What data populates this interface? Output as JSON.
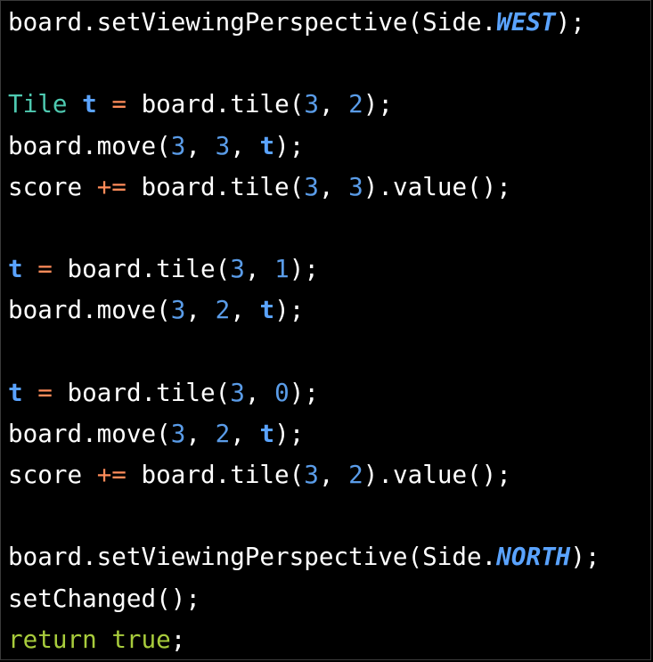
{
  "editor": {
    "colors": {
      "background": "#000000",
      "plain": "#ffffff",
      "type": "#4ec9b0",
      "variable": "#5aa3ff",
      "number": "#5a9ce8",
      "operator": "#ff8c5a",
      "constant": "#5aa3ff",
      "keyword": "#a8cc3c"
    },
    "lines": [
      [
        {
          "t": "board.setViewingPerspective(Side.",
          "k": "plain"
        },
        {
          "t": "WEST",
          "k": "const"
        },
        {
          "t": ");",
          "k": "plain"
        }
      ],
      [],
      [
        {
          "t": "Tile",
          "k": "type"
        },
        {
          "t": " ",
          "k": "plain"
        },
        {
          "t": "t",
          "k": "var"
        },
        {
          "t": " ",
          "k": "plain"
        },
        {
          "t": "=",
          "k": "op"
        },
        {
          "t": " board.tile(",
          "k": "plain"
        },
        {
          "t": "3",
          "k": "num"
        },
        {
          "t": ", ",
          "k": "plain"
        },
        {
          "t": "2",
          "k": "num"
        },
        {
          "t": ");",
          "k": "plain"
        }
      ],
      [
        {
          "t": "board.move(",
          "k": "plain"
        },
        {
          "t": "3",
          "k": "num"
        },
        {
          "t": ", ",
          "k": "plain"
        },
        {
          "t": "3",
          "k": "num"
        },
        {
          "t": ", ",
          "k": "plain"
        },
        {
          "t": "t",
          "k": "var"
        },
        {
          "t": ");",
          "k": "plain"
        }
      ],
      [
        {
          "t": "score ",
          "k": "plain"
        },
        {
          "t": "+=",
          "k": "op"
        },
        {
          "t": " board.tile(",
          "k": "plain"
        },
        {
          "t": "3",
          "k": "num"
        },
        {
          "t": ", ",
          "k": "plain"
        },
        {
          "t": "3",
          "k": "num"
        },
        {
          "t": ").value();",
          "k": "plain"
        }
      ],
      [],
      [
        {
          "t": "t",
          "k": "var"
        },
        {
          "t": " ",
          "k": "plain"
        },
        {
          "t": "=",
          "k": "op"
        },
        {
          "t": " board.tile(",
          "k": "plain"
        },
        {
          "t": "3",
          "k": "num"
        },
        {
          "t": ", ",
          "k": "plain"
        },
        {
          "t": "1",
          "k": "num"
        },
        {
          "t": ");",
          "k": "plain"
        }
      ],
      [
        {
          "t": "board.move(",
          "k": "plain"
        },
        {
          "t": "3",
          "k": "num"
        },
        {
          "t": ", ",
          "k": "plain"
        },
        {
          "t": "2",
          "k": "num"
        },
        {
          "t": ", ",
          "k": "plain"
        },
        {
          "t": "t",
          "k": "var"
        },
        {
          "t": ");",
          "k": "plain"
        }
      ],
      [],
      [
        {
          "t": "t",
          "k": "var"
        },
        {
          "t": " ",
          "k": "plain"
        },
        {
          "t": "=",
          "k": "op"
        },
        {
          "t": " board.tile(",
          "k": "plain"
        },
        {
          "t": "3",
          "k": "num"
        },
        {
          "t": ", ",
          "k": "plain"
        },
        {
          "t": "0",
          "k": "num"
        },
        {
          "t": ");",
          "k": "plain"
        }
      ],
      [
        {
          "t": "board.move(",
          "k": "plain"
        },
        {
          "t": "3",
          "k": "num"
        },
        {
          "t": ", ",
          "k": "plain"
        },
        {
          "t": "2",
          "k": "num"
        },
        {
          "t": ", ",
          "k": "plain"
        },
        {
          "t": "t",
          "k": "var"
        },
        {
          "t": ");",
          "k": "plain"
        }
      ],
      [
        {
          "t": "score ",
          "k": "plain"
        },
        {
          "t": "+=",
          "k": "op"
        },
        {
          "t": " board.tile(",
          "k": "plain"
        },
        {
          "t": "3",
          "k": "num"
        },
        {
          "t": ", ",
          "k": "plain"
        },
        {
          "t": "2",
          "k": "num"
        },
        {
          "t": ").value();",
          "k": "plain"
        }
      ],
      [],
      [
        {
          "t": "board.setViewingPerspective(Side.",
          "k": "plain"
        },
        {
          "t": "NORTH",
          "k": "const"
        },
        {
          "t": ");",
          "k": "plain"
        }
      ],
      [
        {
          "t": "setChanged();",
          "k": "plain"
        }
      ],
      [
        {
          "t": "return",
          "k": "kw"
        },
        {
          "t": " ",
          "k": "plain"
        },
        {
          "t": "true",
          "k": "kw"
        },
        {
          "t": ";",
          "k": "plain"
        }
      ]
    ]
  }
}
